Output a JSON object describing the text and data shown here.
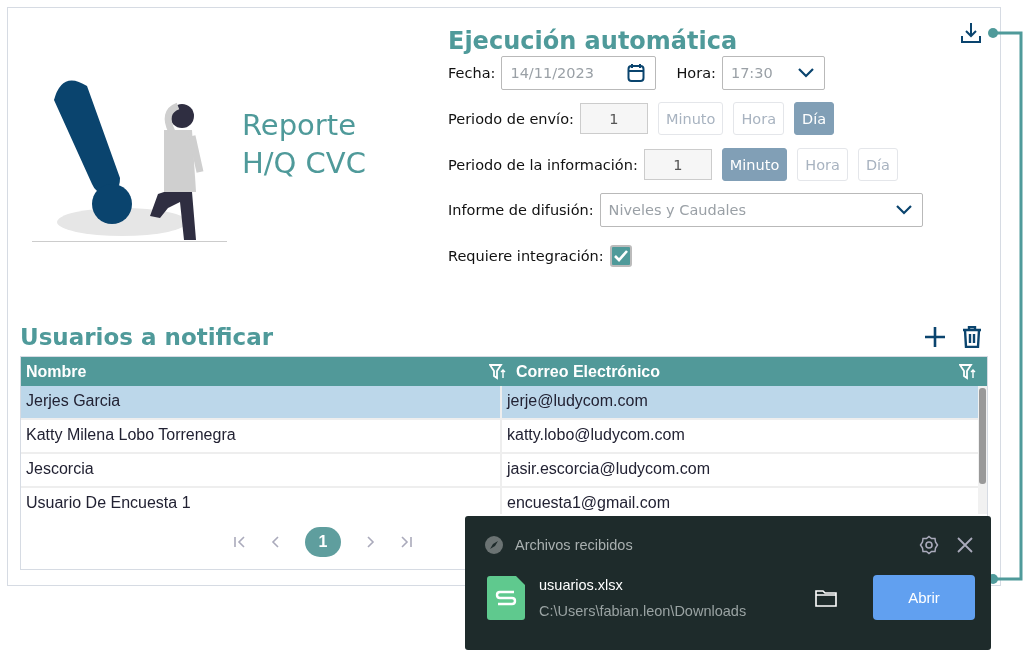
{
  "logo": {
    "title_lines": [
      "Reporte",
      "H/Q CVC"
    ]
  },
  "schedule": {
    "title": "Ejecución automática",
    "date": {
      "label": "Fecha:",
      "value": "14/11/2023"
    },
    "time": {
      "label": "Hora:",
      "value": "17:30"
    },
    "send_period": {
      "label": "Periodo de envío:",
      "value": "1",
      "units": [
        {
          "label": "Minuto",
          "selected": false
        },
        {
          "label": "Hora",
          "selected": false
        },
        {
          "label": "Día",
          "selected": true
        }
      ]
    },
    "info_period": {
      "label": "Periodo de la información:",
      "value": "1",
      "units": [
        {
          "label": "Minuto",
          "selected": true
        },
        {
          "label": "Hora",
          "selected": false
        },
        {
          "label": "Día",
          "selected": false
        }
      ]
    },
    "report": {
      "label": "Informe de difusión:",
      "value": "Niveles y Caudales"
    },
    "integration": {
      "label": "Requiere integración:",
      "checked": true
    }
  },
  "users": {
    "title": "Usuarios a notificar",
    "columns": [
      "Nombre",
      "Correo Electrónico"
    ],
    "rows": [
      {
        "cells": [
          "Jerjes Garcia",
          "jerje@ludycom.com"
        ],
        "selected": true
      },
      {
        "cells": [
          "Katty Milena Lobo Torrenegra",
          "katty.lobo@ludycom.com"
        ],
        "selected": false
      },
      {
        "cells": [
          "Jescorcia",
          "jasir.escorcia@ludycom.com"
        ],
        "selected": false
      },
      {
        "cells": [
          "Usuario De Encuesta 1",
          "encuesta1@gmail.com"
        ],
        "selected": false
      }
    ],
    "pages": [
      {
        "label": "1",
        "selected": true
      }
    ]
  },
  "toast": {
    "title": "Archivos recibidos",
    "file_name": "usuarios.xlsx",
    "path": "C:\\Users\\fabian.leon\\Downloads",
    "button": "Abrir"
  }
}
